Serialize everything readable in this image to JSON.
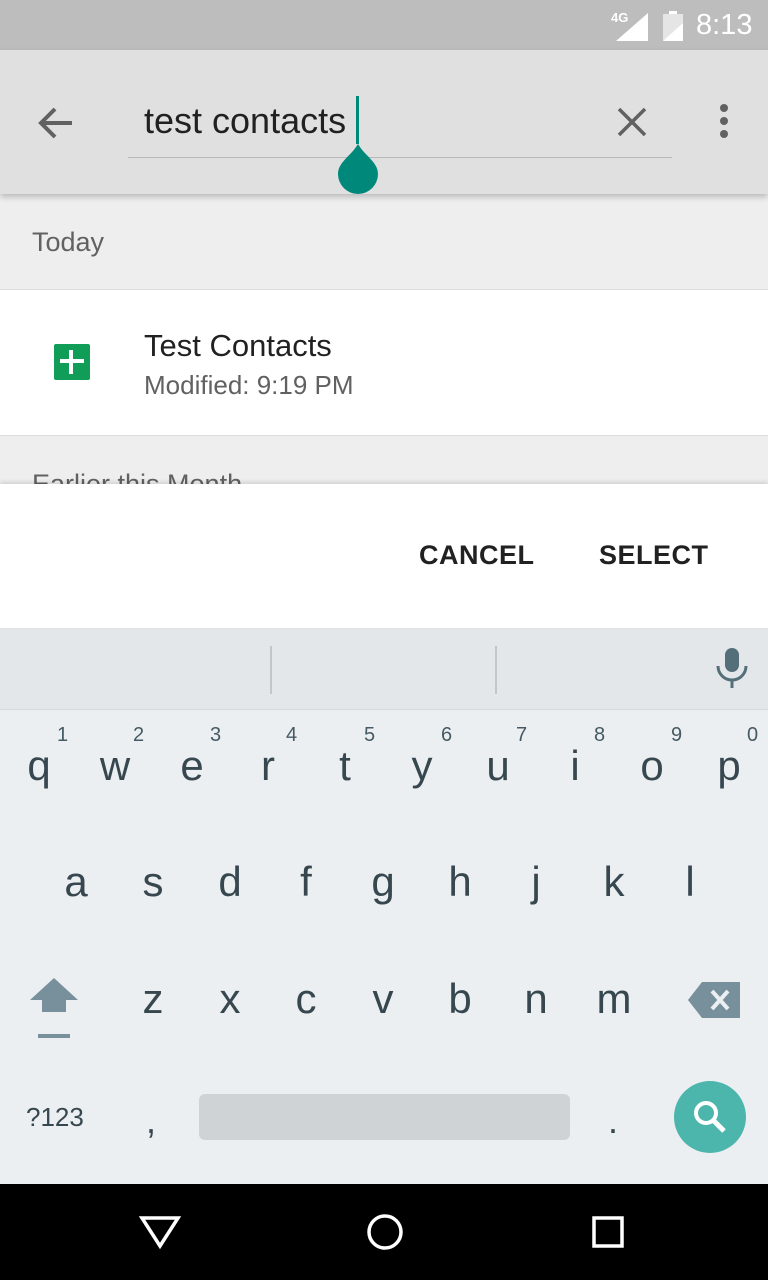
{
  "status_bar": {
    "network": "4G",
    "time": "8:13",
    "icons": [
      "signal-icon",
      "battery-icon"
    ]
  },
  "search": {
    "query": "test contacts",
    "icons": [
      "back-arrow-icon",
      "clear-icon",
      "more-vert-icon"
    ]
  },
  "sections": [
    {
      "header": "Today",
      "items": [
        {
          "name": "Test Contacts",
          "modified": "Modified: 9:19 PM",
          "icon": "sheets-icon"
        }
      ]
    },
    {
      "header": "Earlier this Month",
      "items": []
    }
  ],
  "actions": {
    "cancel": "CANCEL",
    "select": "SELECT"
  },
  "keyboard": {
    "row1": [
      "q",
      "w",
      "e",
      "r",
      "t",
      "y",
      "u",
      "i",
      "o",
      "p"
    ],
    "row1_hints": [
      "1",
      "2",
      "3",
      "4",
      "5",
      "6",
      "7",
      "8",
      "9",
      "0"
    ],
    "row2": [
      "a",
      "s",
      "d",
      "f",
      "g",
      "h",
      "j",
      "k",
      "l"
    ],
    "row3": [
      "z",
      "x",
      "c",
      "v",
      "b",
      "n",
      "m"
    ],
    "symbols": "?123",
    "comma": ",",
    "period": ".",
    "action_icon": "search-icon"
  },
  "nav_bar": {
    "icons": [
      "back-triangle-icon",
      "home-circle-icon",
      "recents-square-icon"
    ]
  },
  "colors": {
    "accent": "#00897b",
    "search_key": "#4db6ac",
    "sheets": "#0f9d58",
    "app_bar": "#e0e0e0"
  }
}
